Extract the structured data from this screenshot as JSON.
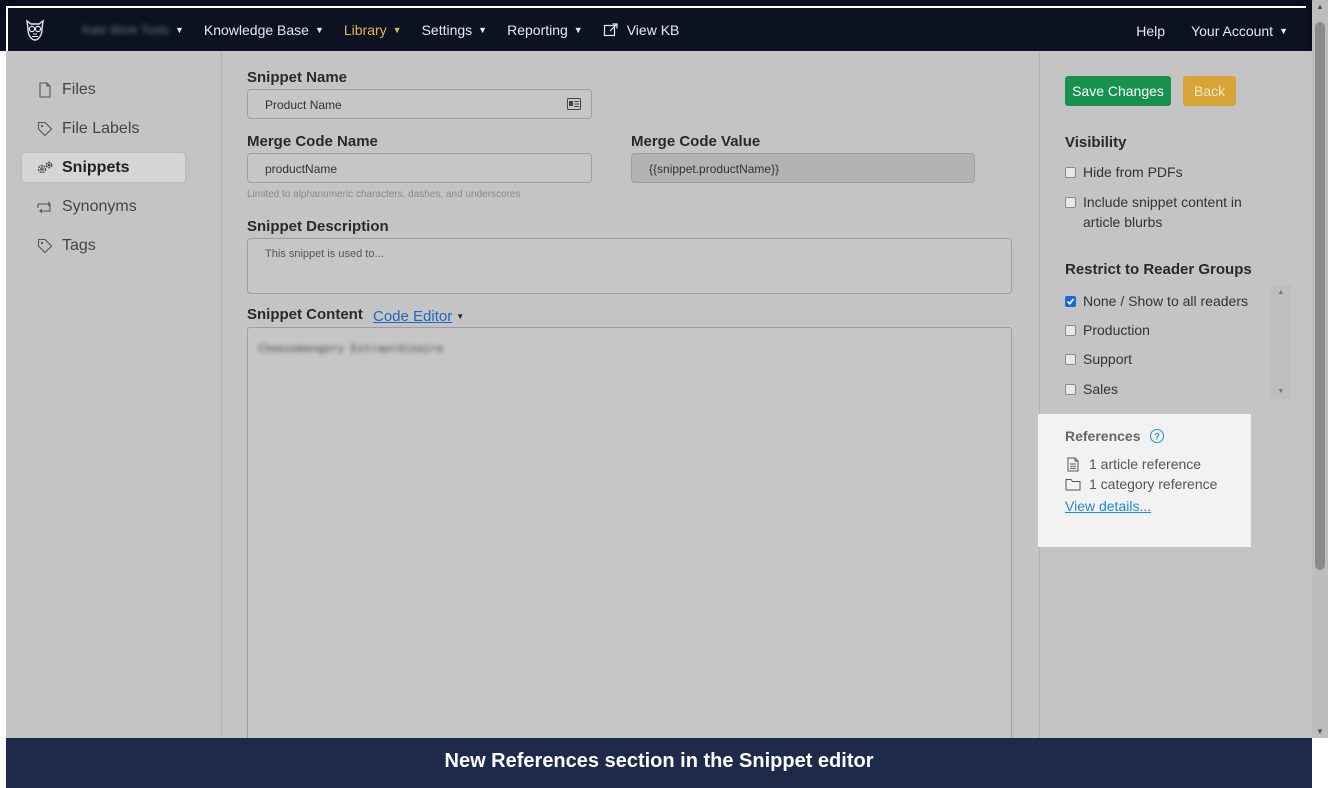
{
  "nav": {
    "brand": "Kate Work Tools",
    "items": [
      {
        "label": "Knowledge Base",
        "active": false,
        "caret": true
      },
      {
        "label": "Library",
        "active": true,
        "caret": true
      },
      {
        "label": "Settings",
        "active": false,
        "caret": true
      },
      {
        "label": "Reporting",
        "active": false,
        "caret": true
      },
      {
        "label": "View KB",
        "active": false,
        "caret": false,
        "icon": "external-link-icon"
      }
    ],
    "help": "Help",
    "account": "Your Account"
  },
  "sidebar": {
    "items": [
      {
        "label": "Files",
        "icon": "file-icon",
        "active": false
      },
      {
        "label": "File Labels",
        "icon": "tag-icon",
        "active": false
      },
      {
        "label": "Snippets",
        "icon": "snippet-gears-icon",
        "active": true
      },
      {
        "label": "Synonyms",
        "icon": "swap-arrows-icon",
        "active": false
      },
      {
        "label": "Tags",
        "icon": "tag-icon",
        "active": false
      }
    ]
  },
  "form": {
    "snippet_name_label": "Snippet Name",
    "snippet_name_value": "Product Name",
    "merge_code_name_label": "Merge Code Name",
    "merge_code_name_value": "productName",
    "merge_code_value_label": "Merge Code Value",
    "merge_code_value_value": "{{snippet.productName}}",
    "merge_code_helper": "Limited to alphanumeric characters, dashes, and underscores",
    "description_label": "Snippet Description",
    "description_placeholder": "This snippet is used to...",
    "content_label": "Snippet Content",
    "editor_mode": "Code Editor",
    "content_value": "Cheesemongery Extraordinaire"
  },
  "right": {
    "save_label": "Save Changes",
    "back_label": "Back",
    "visibility_title": "Visibility",
    "hide_pdfs": "Hide from PDFs",
    "include_blurbs": "Include snippet content in article blurbs",
    "restrict_title": "Restrict to Reader Groups",
    "groups": [
      {
        "label": "None / Show to all readers",
        "checked": true
      },
      {
        "label": "Production",
        "checked": false
      },
      {
        "label": "Support",
        "checked": false
      },
      {
        "label": "Sales",
        "checked": false
      }
    ]
  },
  "references": {
    "title": "References",
    "article_ref": "1 article reference",
    "category_ref": "1 category reference",
    "view_details": "View details..."
  },
  "banner": {
    "text": "New References section in the Snippet editor"
  },
  "colors": {
    "nav_bg": "#0d1222",
    "active_nav": "#e5b54a",
    "save_button": "#17924c",
    "back_button": "#d8a437",
    "link": "#1d8ad6",
    "banner_bg": "#1e2a4a"
  }
}
